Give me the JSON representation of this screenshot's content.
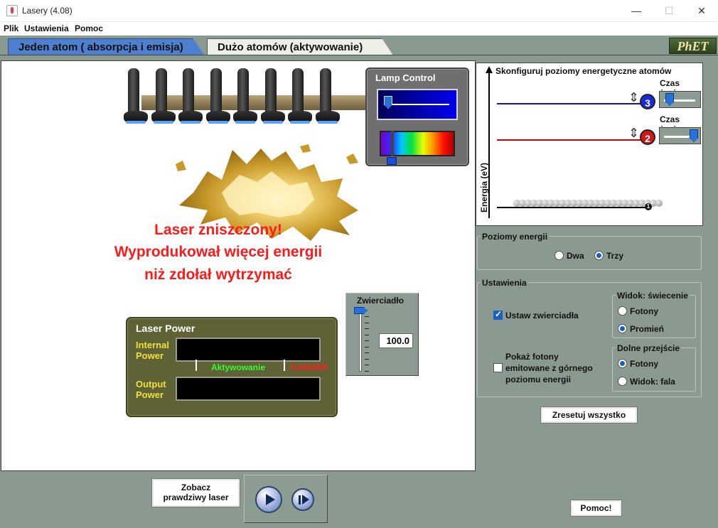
{
  "window": {
    "title": "Lasery (4.08)",
    "minimize": "—",
    "maximize": "☐",
    "close": "✕"
  },
  "menu": [
    "Plik",
    "Ustawienia",
    "Pomoc"
  ],
  "tabs": [
    {
      "label": "Jeden atom ( absorpcja i emisja)",
      "active": false
    },
    {
      "label": "Dużo atomów (aktywowanie)",
      "active": true
    }
  ],
  "logo": "PhET",
  "lamps": {
    "count": 8
  },
  "message": {
    "line1": "Laser zniszczony!",
    "line2": "Wyprodukował więcej energii",
    "line3": "niż zdołał wytrzymać"
  },
  "lamp_control": {
    "title": "Lamp Control",
    "intensity_fraction": 0.0,
    "spectrum_fraction": 0.12
  },
  "laser_power": {
    "title": "Laser Power",
    "internal_label_1": "Internal",
    "internal_label_2": "Power",
    "output_label_1": "Output",
    "output_label_2": "Power",
    "activating_label": "Aktywowanie",
    "danger_label": "DANGER"
  },
  "mirror": {
    "title": "Zwierciadło",
    "value": "100.0"
  },
  "energy_diagram": {
    "title": "Skonfiguruj poziomy energetyczne atomów",
    "ylabel": "Energia (eV)",
    "levels": [
      {
        "badge": "3",
        "color": "#1010d0",
        "lifetime_label": "Czas życia",
        "lifetime_fraction": 0.1
      },
      {
        "badge": "2",
        "color": "#cc0000",
        "lifetime_label": "Czas życia",
        "lifetime_fraction": 0.95
      },
      {
        "badge": "1",
        "color": "#000000"
      }
    ]
  },
  "energy_levels_panel": {
    "title": "Poziomy energii",
    "options": [
      "Dwa",
      "Trzy"
    ],
    "selected": "Trzy"
  },
  "settings_panel": {
    "title": "Ustawienia",
    "set_mirrors": {
      "label": "Ustaw zwierciadła",
      "checked": true
    },
    "show_photons": {
      "line1": "Pokaż fotony",
      "line2": "emitowane z górnego",
      "line3": "poziomu energii",
      "checked": false
    },
    "view_glow": {
      "title": "Widok: świecenie",
      "options": [
        "Fotony",
        "Promień"
      ],
      "selected": "Promień"
    },
    "lower_transition": {
      "title": "Dolne przejście",
      "options": [
        "Fotony",
        "Widok: fala"
      ],
      "selected": "Fotony"
    }
  },
  "buttons": {
    "reset_all": "Zresetuj wszystko",
    "see_real_laser_1": "Zobacz",
    "see_real_laser_2": "prawdziwy laser",
    "help": "Pomoc!"
  }
}
